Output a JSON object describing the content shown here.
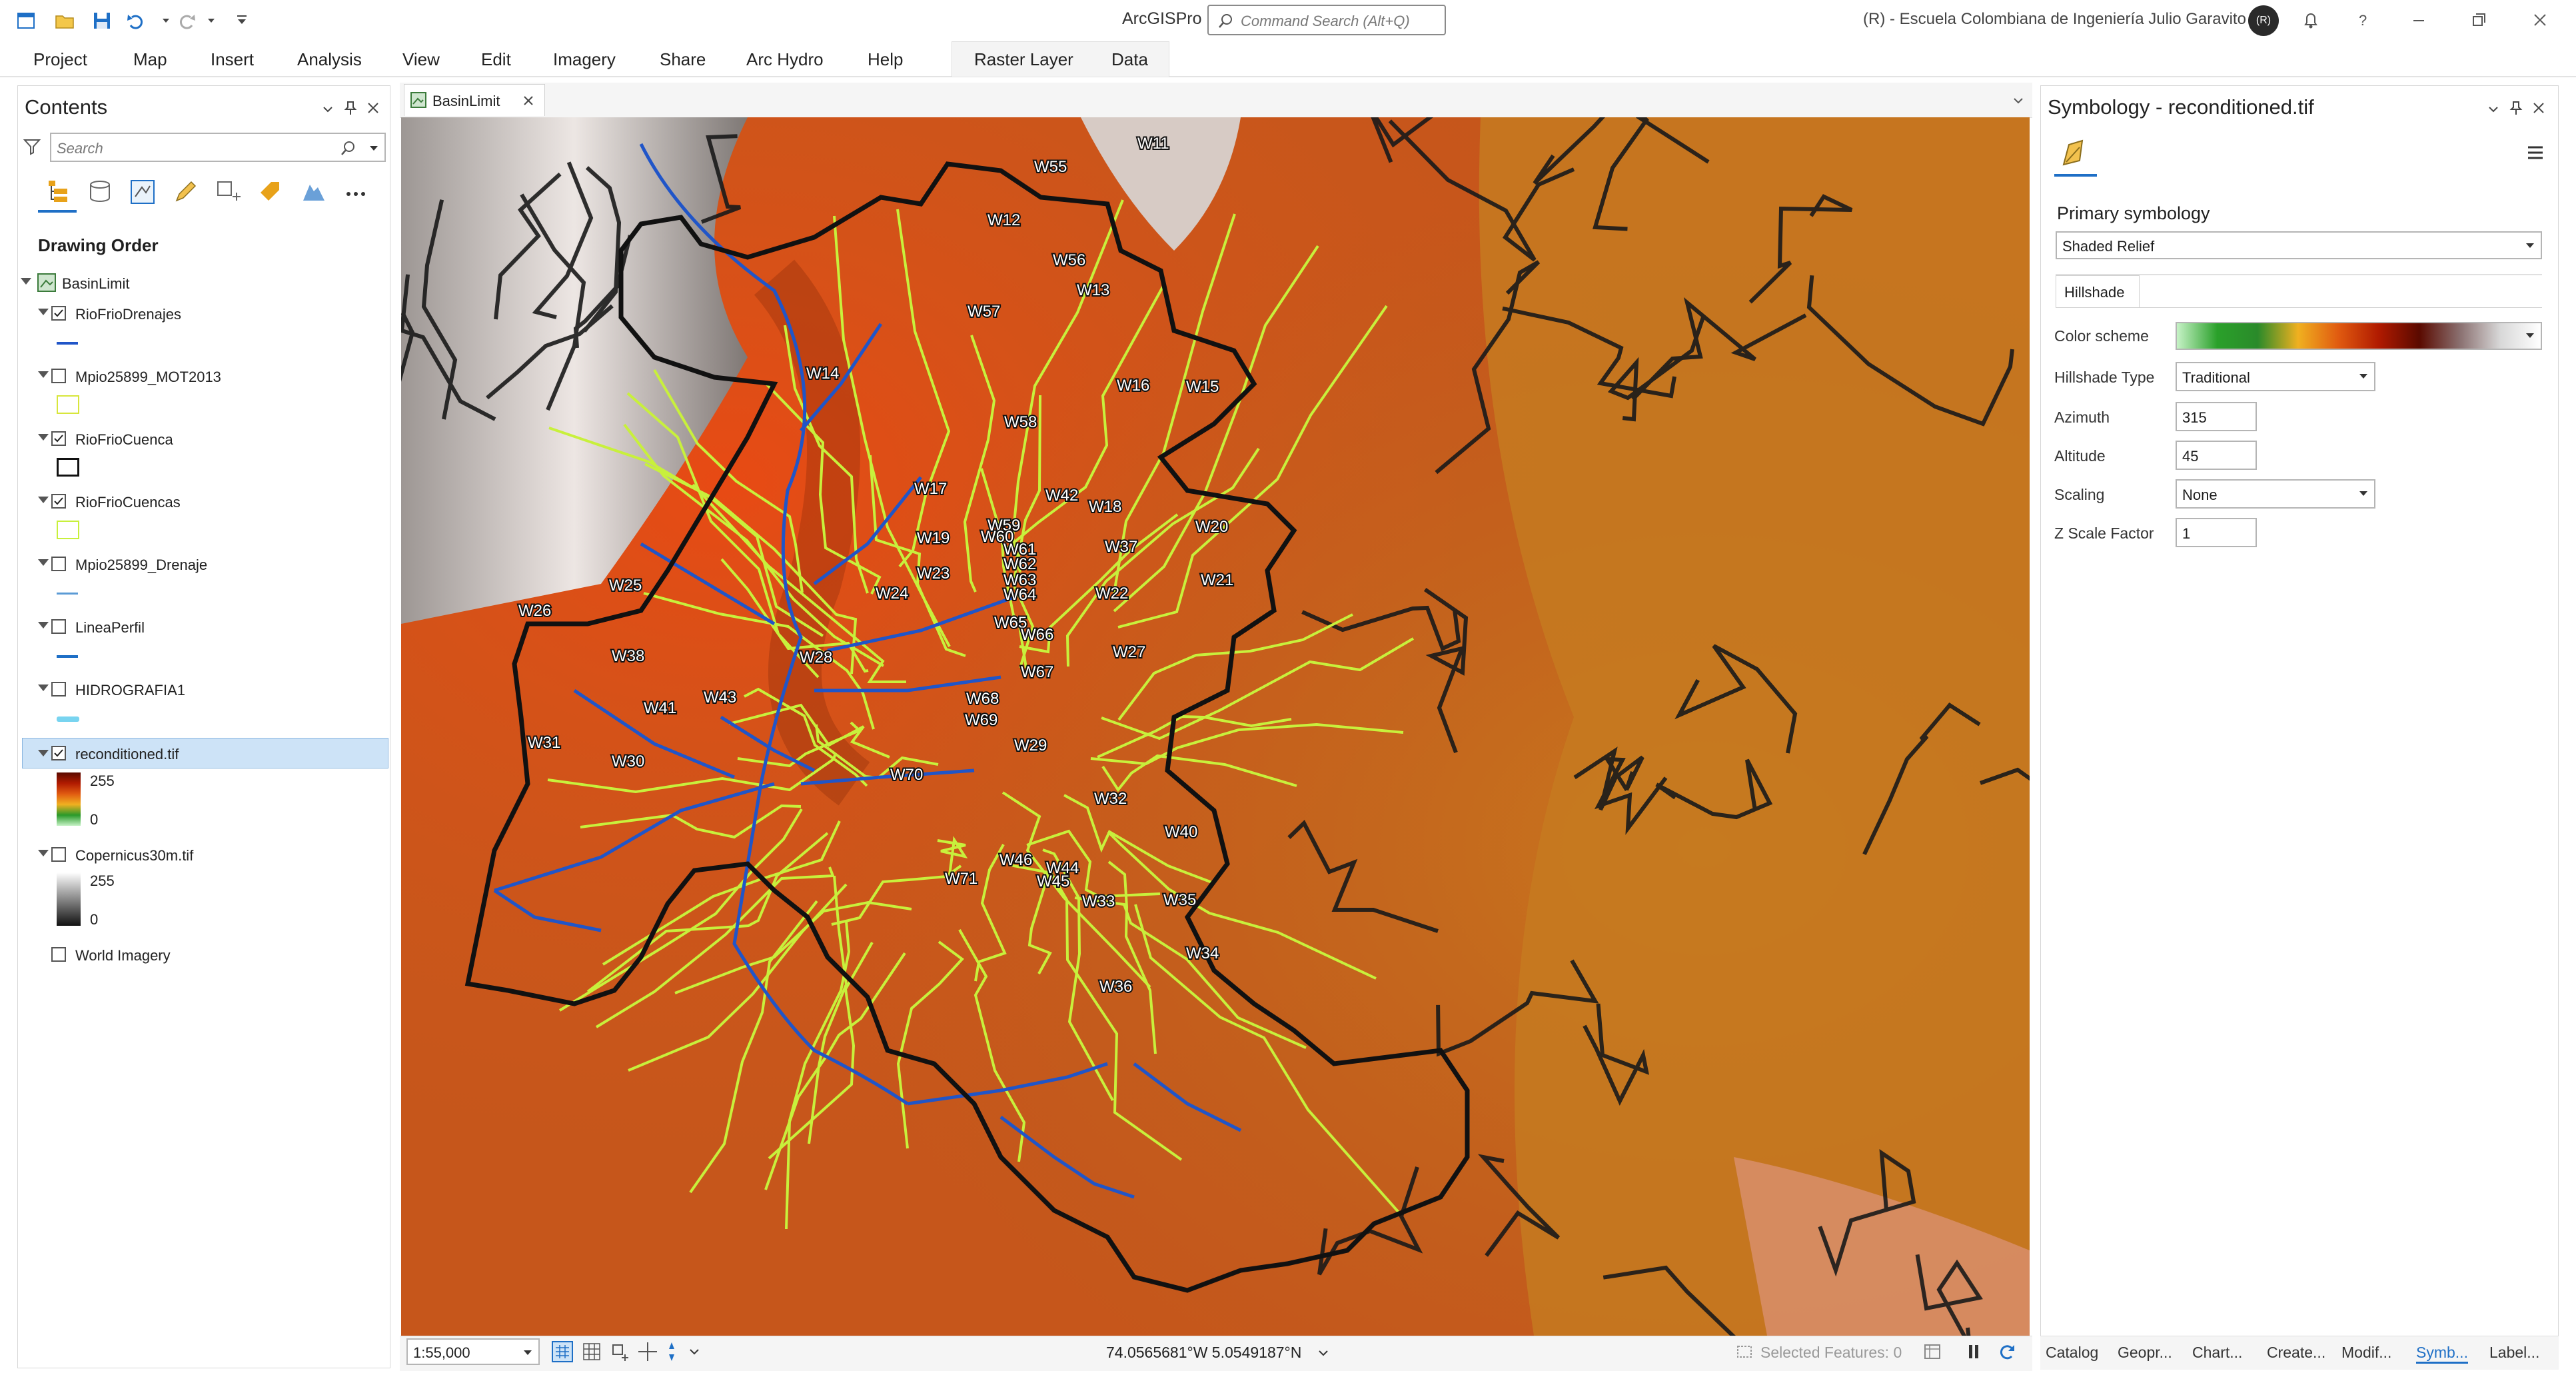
{
  "app": {
    "title": "ArcGISPro",
    "search_placeholder": "Command Search (Alt+Q)",
    "org": "(R) - Escuela Colombiana de Ingeniería Julio Garavito",
    "user_initial": "(R)"
  },
  "ribbon": {
    "tabs": [
      "Project",
      "Map",
      "Insert",
      "Analysis",
      "View",
      "Edit",
      "Imagery",
      "Share",
      "Arc Hydro",
      "Help"
    ],
    "context_tabs": [
      "Raster Layer",
      "Data"
    ]
  },
  "contents": {
    "title": "Contents",
    "search_placeholder": "Search",
    "section": "Drawing Order",
    "map_name": "BasinLimit",
    "layers": [
      {
        "name": "RioFrioDrenajes",
        "checked": true
      },
      {
        "name": "Mpio25899_MOT2013",
        "checked": false
      },
      {
        "name": "RioFrioCuenca",
        "checked": true
      },
      {
        "name": "RioFrioCuencas",
        "checked": true
      },
      {
        "name": "Mpio25899_Drenaje",
        "checked": false
      },
      {
        "name": "LineaPerfil",
        "checked": false
      },
      {
        "name": "HIDROGRAFIA1",
        "checked": false
      },
      {
        "name": "reconditioned.tif",
        "checked": true
      },
      {
        "name": "Copernicus30m.tif",
        "checked": false
      },
      {
        "name": "World Imagery",
        "checked": false
      }
    ],
    "reconditioned_legend": {
      "high": "255",
      "low": "0"
    },
    "copernicus_legend": {
      "high": "255",
      "low": "0"
    }
  },
  "map": {
    "tab_label": "BasinLimit",
    "scale": "1:55,000",
    "coordinates": "74.0565681°W 5.0549187°N",
    "selected_features": "Selected Features: 0",
    "subbasin_labels": [
      "W11",
      "W55",
      "W12",
      "W56",
      "W13",
      "W57",
      "W14",
      "W16",
      "W15",
      "W58",
      "W17",
      "W42",
      "W18",
      "W20",
      "W59",
      "W19",
      "W60",
      "W61",
      "W37",
      "W62",
      "W23",
      "W63",
      "W25",
      "W21",
      "W24",
      "W64",
      "W22",
      "W26",
      "W65",
      "W66",
      "W38",
      "W28",
      "W27",
      "W67",
      "W43",
      "W68",
      "W41",
      "W69",
      "W29",
      "W31",
      "W30",
      "W70",
      "W32",
      "W40",
      "W46",
      "W44",
      "W71",
      "W45",
      "W35",
      "W33",
      "W34",
      "W36"
    ]
  },
  "symbology": {
    "title": "Symbology - reconditioned.tif",
    "primary_label": "Primary symbology",
    "primary_value": "Shaded Relief",
    "tab": "Hillshade",
    "color_scheme_label": "Color scheme",
    "hillshade_type_label": "Hillshade Type",
    "hillshade_type_value": "Traditional",
    "azimuth_label": "Azimuth",
    "azimuth_value": "315",
    "altitude_label": "Altitude",
    "altitude_value": "45",
    "scaling_label": "Scaling",
    "scaling_value": "None",
    "zfactor_label": "Z Scale Factor",
    "zfactor_value": "1"
  },
  "bottom_tabs": [
    "Catalog",
    "Geopr...",
    "Chart...",
    "Create...",
    "Modif...",
    "Symb...",
    "Label..."
  ],
  "colors": {
    "accent": "#1e6fc6",
    "selected_row": "#cde3f7",
    "basin_outline": "#111111",
    "subbasin_line": "#c8f03c",
    "stream": "#2055c8",
    "map_base": "#cc5a1e"
  }
}
